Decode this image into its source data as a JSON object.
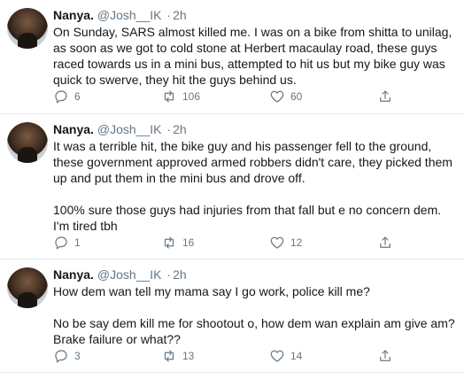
{
  "tweets": [
    {
      "name": "Nanya.",
      "handle": "@Josh__IK",
      "separator": "·",
      "time": "2h",
      "paragraphs": [
        "On Sunday,  SARS almost killed me. I was on a bike from shitta to unilag, as soon as we got to cold stone at Herbert macaulay road, these guys raced towards us in a mini bus, attempted to hit us but my bike guy was quick to swerve, they hit the guys behind us."
      ],
      "replies": "6",
      "retweets": "106",
      "likes": "60"
    },
    {
      "name": "Nanya.",
      "handle": "@Josh__IK",
      "separator": "·",
      "time": "2h",
      "paragraphs": [
        "It was a terrible hit, the bike guy and his passenger fell to the ground, these government approved armed robbers didn't care, they picked them up and put them in the mini bus and drove off.",
        "100% sure those guys had injuries from that fall but e no concern dem. I'm tired tbh"
      ],
      "replies": "1",
      "retweets": "16",
      "likes": "12"
    },
    {
      "name": "Nanya.",
      "handle": "@Josh__IK",
      "separator": "·",
      "time": "2h",
      "paragraphs": [
        "How dem wan tell my mama say I go work, police kill me?",
        "No be say dem kill me for shootout o, how dem wan explain am give am? Brake failure or what??"
      ],
      "replies": "3",
      "retweets": "13",
      "likes": "14"
    }
  ],
  "icons": {
    "reply": "reply-icon",
    "retweet": "retweet-icon",
    "like": "heart-icon",
    "share": "share-icon"
  },
  "colors": {
    "text": "#14171a",
    "muted": "#657786",
    "divider": "#e6ecf0"
  }
}
